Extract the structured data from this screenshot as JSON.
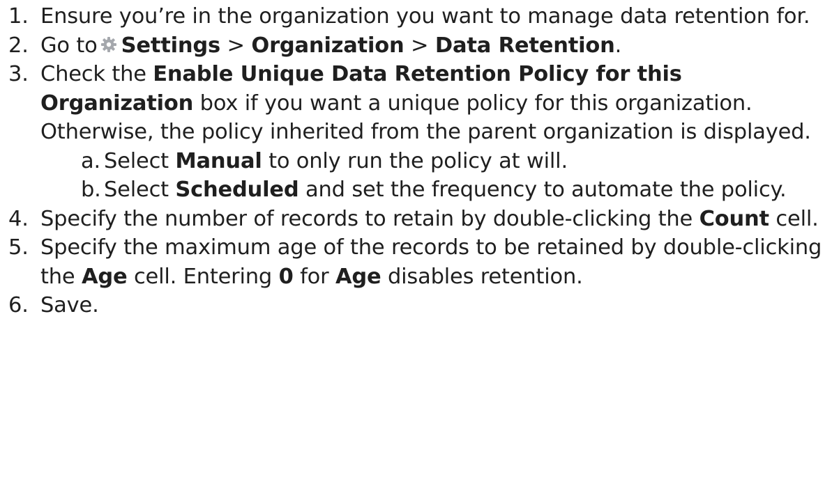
{
  "colors": {
    "text": "#1f1f1f",
    "gear_icon": "#a5a8ad"
  },
  "steps": [
    {
      "num": "1.",
      "text": "Ensure you’re in the organization you want to manage data retention for."
    },
    {
      "num": "2.",
      "pre": "Go to",
      "icon": "gear-icon",
      "settings": "Settings",
      "sep1": " > ",
      "organization": "Organization",
      "sep2": " > ",
      "data_retention": "Data Retention",
      "end": "."
    },
    {
      "num": "3.",
      "pre": "Check the ",
      "checkbox_label": "Enable Unique Data Retention Policy for this Organization",
      "post": " box if you want a unique policy for this organization. Otherwise, the policy inherited from the parent organization is displayed.",
      "sub": [
        {
          "num": "a.",
          "pre": "Select ",
          "option": "Manual",
          "post": " to only run the policy at will."
        },
        {
          "num": "b.",
          "pre": "Select ",
          "option": "Scheduled",
          "post": " and set the frequency to automate the policy."
        }
      ]
    },
    {
      "num": "4.",
      "pre": "Specify the number of records to retain by double-clicking the ",
      "cell": "Count",
      "post": " cell."
    },
    {
      "num": "5.",
      "pre": "Specify the maximum age of the records to be retained by double-clicking the ",
      "cell": "Age",
      "mid": " cell. Entering ",
      "value": "0",
      "mid2": " for ",
      "cell2": "Age",
      "post": " disables retention."
    },
    {
      "num": "6.",
      "text": "Save."
    }
  ]
}
